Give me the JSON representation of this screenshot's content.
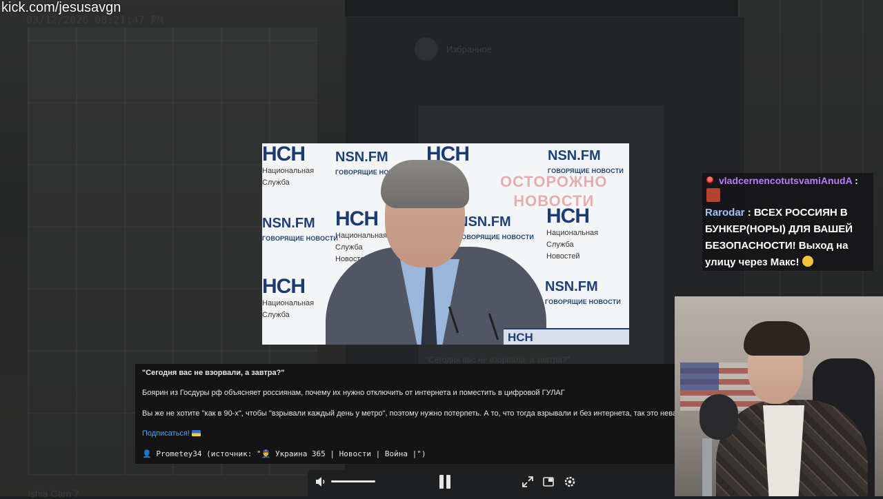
{
  "watermark": {
    "url": "kick.com/jesusavgn",
    "date_ghost": "03/12/2026 08:21:47 PM",
    "bottom_ghost": "Ishia  Cam 7"
  },
  "background_window": {
    "ghost_title": "Избранное",
    "ghost_caption": "\"Сегодня вас не взорвали, а завтра?\""
  },
  "video": {
    "logos": {
      "nsn": "NSN.FM",
      "nsn_sub": "ГОВОРЯЩИЕ НОВОСТИ",
      "nch": "НСН",
      "nch_sub_1": "Национальная",
      "nch_sub_2": "Служба",
      "nch_sub_3": "Новостей"
    },
    "overlay_line1": "ОСТОРОЖНО",
    "overlay_line2": "НОВОСТИ",
    "lower_third": "НСН"
  },
  "post": {
    "title": "\"Сегодня вас не взорвали, а завтра?\"",
    "line1": "Боярин из Госдуры рф объясняет россиянам, почему их нужно отключить от интернета и поместить в цифровой ГУЛАГ",
    "line2": "Вы же не хотите \"как в 90-х\", чтобы \"взрывали каждый день у метро\", поэтому нужно потерпеть. А то, что тогда взрывали и без интернета, так это неважно",
    "subscribe": "Подписаться!",
    "source": "👤 Prometey34 (источник: \"👮 Украина 365 | Новости | Война |\")"
  },
  "player": {
    "volume_level": 0.75
  },
  "chat": {
    "user1": "vladcernencotutsvamiAnudA",
    "colon": ":",
    "user2": "Rarodar",
    "message": "ВСЕХ РОССИЯН В БУНКЕР(НОРЫ) ДЛЯ ВАШЕЙ БЕЗОПАСНОСТИ! Выход на улицу через Макс!",
    "colors": {
      "user1": "#b77cff",
      "user2": "#9fc3ff"
    }
  }
}
